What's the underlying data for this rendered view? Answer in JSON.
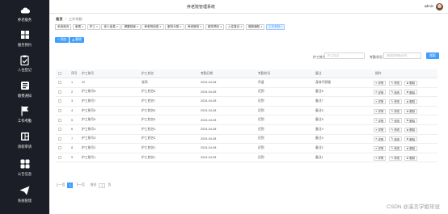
{
  "sidebar": {
    "items": [
      {
        "label": "养老服务",
        "icon": "cloud-icon"
      },
      {
        "label": "服务预约",
        "icon": "grid-icon"
      },
      {
        "label": "入住登记",
        "icon": "clipboard-icon"
      },
      {
        "label": "缴费通知",
        "icon": "notification-icon"
      },
      {
        "label": "工作考勤",
        "icon": "flag-icon"
      },
      {
        "label": "请假审请",
        "icon": "layout-icon"
      },
      {
        "label": "公告信息",
        "icon": "apps-icon"
      },
      {
        "label": "系统管理",
        "icon": "send-icon"
      }
    ],
    "active_index": 4
  },
  "header": {
    "title": "养老院管理系统",
    "user": "admin"
  },
  "breadcrumb": {
    "home": "首页",
    "current": "工作考勤"
  },
  "tags": [
    "系统首页",
    "家属",
    "护工",
    "老人信息",
    "健康档案",
    "养老院信息",
    "服务分类",
    "养老服务",
    "服务预约",
    "入住登记",
    "缴费通知",
    "工作考勤"
  ],
  "toolbar": {
    "add": "+ 添加",
    "delete": "删除"
  },
  "search": {
    "name_label": "护工姓名",
    "name_placeholder": "护工姓名",
    "status_label": "考勤状况",
    "status_placeholder": "请选择考勤状况",
    "button": "搜索"
  },
  "table": {
    "headers": [
      "序号",
      "护工账号",
      "护工姓名",
      "考勤日期",
      "考勤状况",
      "备注",
      "操作"
    ],
    "rows": [
      {
        "index": "1",
        "account": "22",
        "name": "张四",
        "date": "2024-04-08",
        "status": "早退",
        "remark": "身体不舒服"
      },
      {
        "index": "2",
        "account": "护工账号8",
        "name": "护工姓名8",
        "date": "2024-04-08",
        "status": "迟到",
        "remark": "备注8"
      },
      {
        "index": "3",
        "account": "护工账号7",
        "name": "护工姓名7",
        "date": "2024-04-08",
        "status": "迟到",
        "remark": "备注7"
      },
      {
        "index": "4",
        "account": "护工账号6",
        "name": "护工姓名6",
        "date": "2024-04-08",
        "status": "迟到",
        "remark": "备注6"
      },
      {
        "index": "5",
        "account": "护工账号5",
        "name": "护工姓名5",
        "date": "2024-04-08",
        "status": "迟到",
        "remark": "备注5"
      },
      {
        "index": "6",
        "account": "护工账号4",
        "name": "护工姓名4",
        "date": "2024-04-08",
        "status": "迟到",
        "remark": "备注4"
      },
      {
        "index": "7",
        "account": "护工账号3",
        "name": "护工姓名3",
        "date": "2024-04-08",
        "status": "迟到",
        "remark": "备注3"
      },
      {
        "index": "8",
        "account": "护工账号2",
        "name": "护工姓名2",
        "date": "2024-04-08",
        "status": "迟到",
        "remark": "备注2"
      },
      {
        "index": "9",
        "account": "护工账号1",
        "name": "护工姓名1",
        "date": "2024-04-08",
        "status": "迟到",
        "remark": "备注1"
      }
    ],
    "actions": {
      "detail": "详情",
      "edit": "修改",
      "delete": "删除"
    }
  },
  "pagination": {
    "prev": "上一页",
    "page": "1",
    "next": "下一页",
    "goto": "前往",
    "input": "1",
    "page_unit": "页"
  },
  "watermark": "CSDN @溪言学姐毕设",
  "colors": {
    "accent": "#409eff",
    "sidebar_bg": "#1b1e26"
  }
}
